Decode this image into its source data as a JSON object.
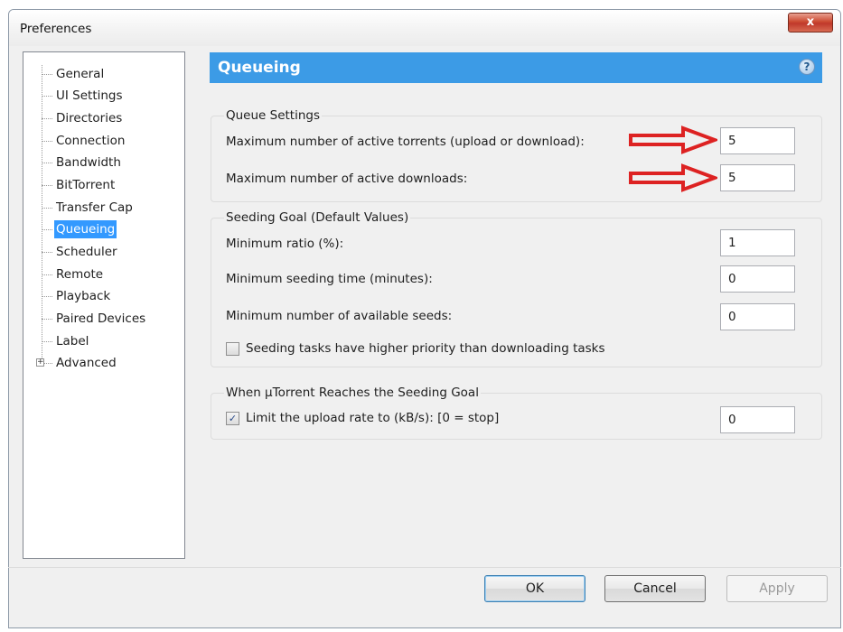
{
  "window": {
    "title": "Preferences",
    "close_glyph": "x"
  },
  "tree": {
    "items": [
      {
        "label": "General"
      },
      {
        "label": "UI Settings"
      },
      {
        "label": "Directories"
      },
      {
        "label": "Connection"
      },
      {
        "label": "Bandwidth"
      },
      {
        "label": "BitTorrent"
      },
      {
        "label": "Transfer Cap"
      },
      {
        "label": "Queueing",
        "selected": true
      },
      {
        "label": "Scheduler"
      },
      {
        "label": "Remote"
      },
      {
        "label": "Playback"
      },
      {
        "label": "Paired Devices"
      },
      {
        "label": "Label"
      },
      {
        "label": "Advanced",
        "expandable": true
      }
    ],
    "expander_glyph": "+"
  },
  "panel": {
    "title": "Queueing",
    "help_glyph": "?",
    "accent_color": "#3c9be6",
    "queue_settings": {
      "title": "Queue Settings",
      "max_active_torrents_label": "Maximum number of active torrents (upload or download):",
      "max_active_torrents_value": "5",
      "max_active_downloads_label": "Maximum number of active downloads:",
      "max_active_downloads_value": "5"
    },
    "seeding_goal": {
      "title": "Seeding Goal (Default Values)",
      "min_ratio_label": "Minimum ratio (%):",
      "min_ratio_value": "1",
      "min_seed_time_label": "Minimum seeding time (minutes):",
      "min_seed_time_value": "0",
      "min_seeds_label": "Minimum number of available seeds:",
      "min_seeds_value": "0",
      "priority_label": "Seeding tasks have higher priority than downloading tasks",
      "priority_checked": false
    },
    "reaches_goal": {
      "title": "When µTorrent Reaches the Seeding Goal",
      "limit_label": "Limit the upload rate to (kB/s): [0 = stop]",
      "limit_checked": true,
      "limit_value": "0",
      "check_glyph": "✓"
    },
    "annotation_arrow_color": "#dd2222"
  },
  "buttons": {
    "ok": "OK",
    "cancel": "Cancel",
    "apply": "Apply"
  }
}
